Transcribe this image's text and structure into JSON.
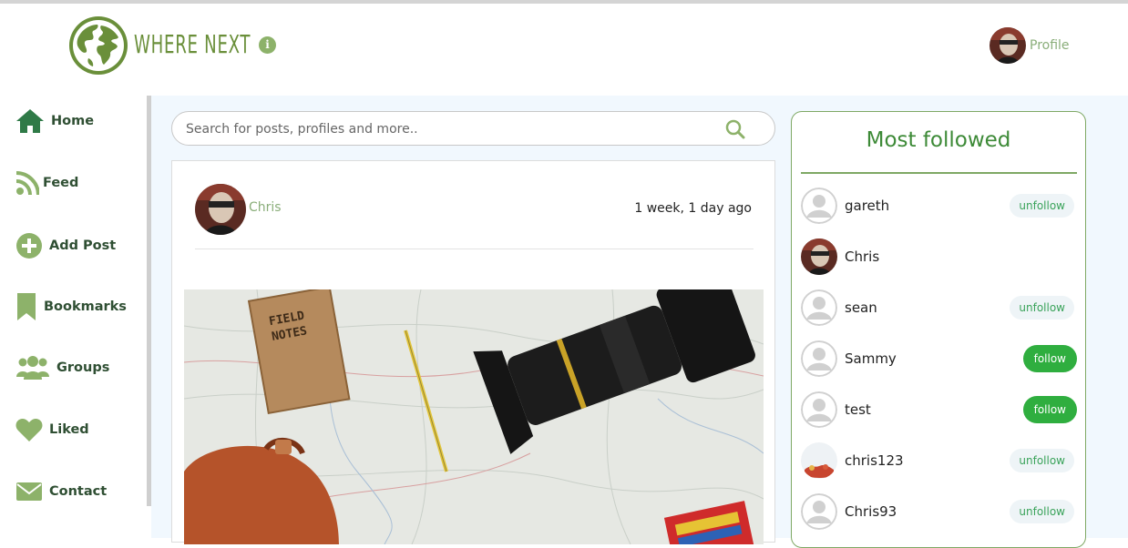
{
  "header": {
    "brand": "WHERE NEXT",
    "info_icon": "info-icon",
    "profile_label": "Profile"
  },
  "sidebar": {
    "items": [
      {
        "label": "Home",
        "icon": "home-icon"
      },
      {
        "label": "Feed",
        "icon": "rss-feed-icon"
      },
      {
        "label": "Add Post",
        "icon": "plus-circle-icon"
      },
      {
        "label": "Bookmarks",
        "icon": "bookmark-icon"
      },
      {
        "label": "Groups",
        "icon": "users-icon"
      },
      {
        "label": "Liked",
        "icon": "heart-icon"
      },
      {
        "label": "Contact",
        "icon": "envelope-icon"
      }
    ]
  },
  "search": {
    "placeholder": "Search for posts, profiles and more.."
  },
  "post": {
    "author": "Chris",
    "time": "1 week, 1 day ago",
    "photo_text": "FIELD NOTES"
  },
  "most_followed": {
    "title": "Most followed",
    "users": [
      {
        "name": "gareth",
        "action": "unfollow"
      },
      {
        "name": "Chris",
        "action": ""
      },
      {
        "name": "sean",
        "action": "unfollow"
      },
      {
        "name": "Sammy",
        "action": "follow"
      },
      {
        "name": "test",
        "action": "follow"
      },
      {
        "name": "chris123",
        "action": "unfollow"
      },
      {
        "name": "Chris93",
        "action": "unfollow"
      }
    ]
  },
  "colors": {
    "brand_green": "#6a8f3a",
    "follow_green": "#2fae3f",
    "main_bg": "#f1f8fe"
  }
}
